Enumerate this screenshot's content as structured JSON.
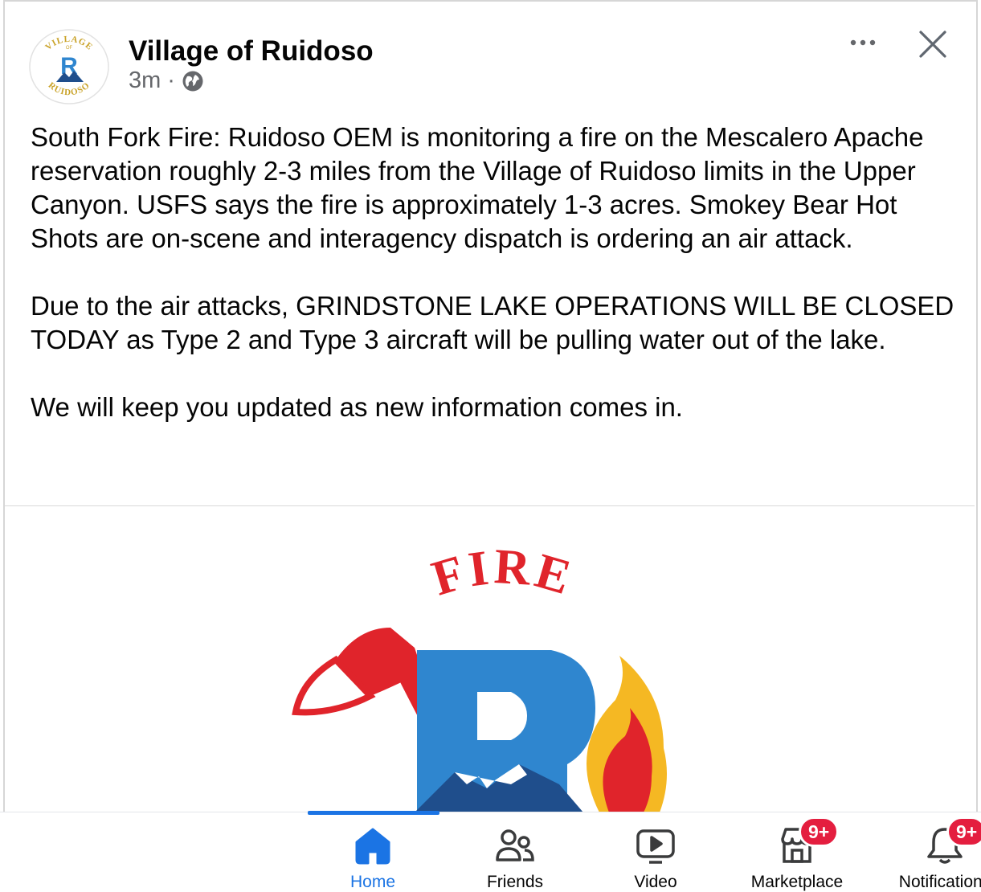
{
  "post": {
    "page_name": "Village of Ruidoso",
    "timestamp": "3m",
    "separator": "·",
    "paragraphs": [
      "South Fork Fire: Ruidoso OEM is monitoring a fire on the Mescalero Apache reservation roughly 2-3 miles from the Village of Ruidoso limits in the Upper Canyon. USFS says the fire is approximately 1-3 acres. Smokey Bear Hot Shots are on-scene and interagency dispatch is ordering an air attack.",
      "Due to the air attacks, GRINDSTONE LAKE OPERATIONS WILL BE CLOSED TODAY as Type 2 and Type 3 aircraft will be pulling water out of the lake.",
      "We will keep you updated as new information comes in."
    ],
    "avatar_text_top": "VILLAGE",
    "avatar_text_of": "OF",
    "avatar_text_bottom": "RUIDOSO",
    "image_title": "FIRE"
  },
  "icons": {
    "more": "more-icon",
    "close": "close-icon",
    "audience": "globe-icon"
  },
  "tabbar": {
    "tabs": [
      {
        "label": "Home",
        "icon": "home-icon",
        "active": true
      },
      {
        "label": "Friends",
        "icon": "friends-icon"
      },
      {
        "label": "Video",
        "icon": "video-icon"
      },
      {
        "label": "Marketplace",
        "icon": "marketplace-icon",
        "badge": "9+"
      },
      {
        "label": "Notifications",
        "icon": "bell-icon",
        "badge": "9+"
      }
    ]
  },
  "colors": {
    "accent": "#1b74e4",
    "badge": "#e41e3f",
    "logo_blue": "#2f86cf",
    "fire_red": "#e0242b",
    "flame_yellow": "#f5b823"
  }
}
